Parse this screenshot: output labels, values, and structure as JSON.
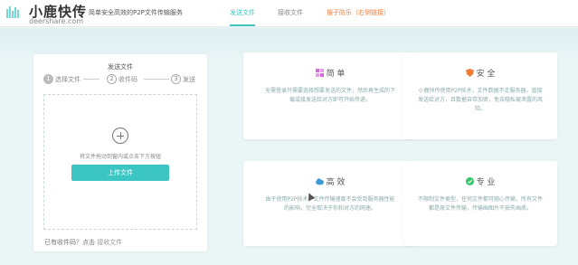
{
  "header": {
    "logo_cn": "小鹿快传",
    "logo_en": "deershare.com",
    "slogan": "简单安全高效的P2P文件传输服务",
    "nav": [
      "发送文件",
      "接收文件",
      "搜子防乐（右侧链接）"
    ]
  },
  "send_card": {
    "title": "发送文件",
    "steps": [
      {
        "num": "1",
        "label": "选择文件"
      },
      {
        "num": "2",
        "label": "收件码"
      },
      {
        "num": "3",
        "label": "发送"
      }
    ],
    "drop_hint": "将文件拖动到窗内或点击下方按钮",
    "upload_button": "上传文件",
    "footer_text": "已有收件码？点击",
    "footer_link": "接收文件"
  },
  "features": [
    {
      "title": "简 单",
      "icon": "grid-icon",
      "color": "#d66bd6",
      "body": "无需登录只需要选择想要发送的文件，然后再生成的下载或接发送给对方即可开始传递。"
    },
    {
      "title": "安 全",
      "icon": "shield-icon",
      "color": "#f07d3a",
      "body": "小鹿快传使用P2P技术，文件数据不走服务器，直接发送给对方，且数据自带加密，免去隐私被泄露的风险。"
    },
    {
      "title": "高 效",
      "icon": "cloud-icon",
      "color": "#3c9bd6",
      "body": "由于使用P2P技术，文件传输速度不会受到服务器性能的影响，完全取决于你和对方的网速。"
    },
    {
      "title": "专 业",
      "icon": "check-circle-icon",
      "color": "#35c46a",
      "body": "不限制文件类型，任何文件都可随心传输，所有文件都是原文件传输，传输画图片不损失画质。"
    }
  ]
}
